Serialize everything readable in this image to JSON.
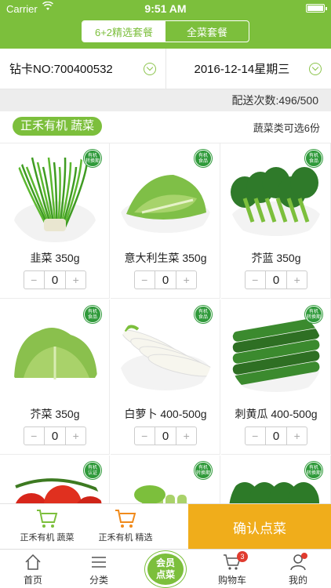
{
  "status_bar": {
    "carrier": "Carrier",
    "time": "9:51 AM"
  },
  "segments": {
    "active": "6+2精选套餐",
    "inactive": "全菜套餐"
  },
  "selectors": {
    "card": "钻卡NO:700400532",
    "date": "2016-12-14星期三"
  },
  "delivery": "配送次数:496/500",
  "category": {
    "label": "正禾有机 蔬菜",
    "note": "蔬菜类可选6份"
  },
  "items": [
    {
      "name": "韭菜 350g",
      "qty": "0",
      "badge": "有机\n转换期",
      "kind": "chive"
    },
    {
      "name": "意大利生菜 350g",
      "qty": "0",
      "badge": "有机\n食品",
      "kind": "lettuce"
    },
    {
      "name": "芥蓝 350g",
      "qty": "0",
      "badge": "有机\n食品",
      "kind": "kailan"
    },
    {
      "name": "芥菜 350g",
      "qty": "0",
      "badge": "有机\n食品",
      "kind": "mustard"
    },
    {
      "name": "白萝卜 400-500g",
      "qty": "0",
      "badge": "有机\n食品",
      "kind": "radish"
    },
    {
      "name": "刺黄瓜 400-500g",
      "qty": "0",
      "badge": "有机\n转换期",
      "kind": "cucumber"
    },
    {
      "name": "",
      "qty": "",
      "badge": "有机\n认证",
      "kind": "tomato"
    },
    {
      "name": "",
      "qty": "",
      "badge": "有机\n转换期",
      "kind": "celery"
    },
    {
      "name": "",
      "qty": "",
      "badge": "有机\n转换期",
      "kind": "spinach"
    }
  ],
  "stepper": {
    "minus": "−",
    "plus": "+"
  },
  "packages": [
    {
      "label": "正禾有机 蔬菜"
    },
    {
      "label": "正禾有机 精选"
    }
  ],
  "confirm_label": "确认点菜",
  "tabs": {
    "home": "首页",
    "category": "分类",
    "member": "会员\n点菜",
    "cart": "购物车",
    "mine": "我的",
    "cart_count": "3"
  },
  "colors": {
    "primary": "#7cbf3c",
    "confirm": "#f0ad1b",
    "badge": "#2f9a3a",
    "alert": "#e03b2f"
  }
}
